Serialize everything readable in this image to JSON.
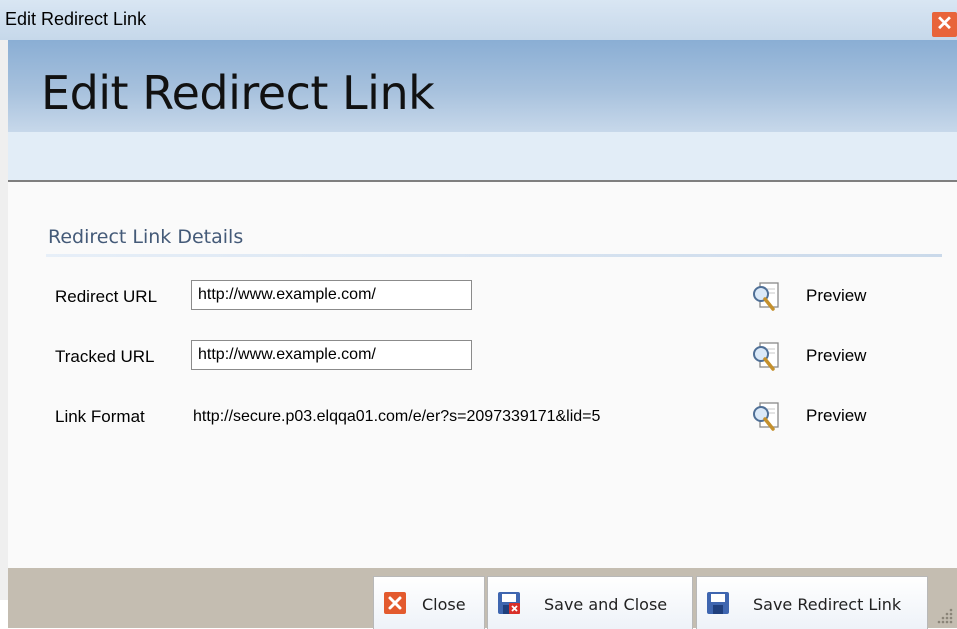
{
  "window": {
    "title": "Edit Redirect Link",
    "close_symbol": "✕",
    "header_title": "Edit Redirect Link"
  },
  "section": {
    "title": "Redirect Link Details"
  },
  "fields": {
    "redirect_url": {
      "label": "Redirect URL",
      "value": "http://www.example.com/"
    },
    "tracked_url": {
      "label": "Tracked URL",
      "value": "http://www.example.com/"
    },
    "link_format": {
      "label": "Link Format",
      "value": "http://secure.p03.elqqa01.com/e/er?s=2097339171&lid=5"
    }
  },
  "preview": {
    "label": "Preview",
    "icon": "document-magnifier-icon"
  },
  "footer": {
    "close_label": "Close",
    "save_close_label": "Save and Close",
    "save_label": "Save Redirect Link"
  },
  "colors": {
    "header_gradient_top": "#8aaed4",
    "sub_band": "#e2edf7",
    "footer": "#c4bdb1",
    "close_button": "#e8643a",
    "section_title": "#445a78"
  }
}
